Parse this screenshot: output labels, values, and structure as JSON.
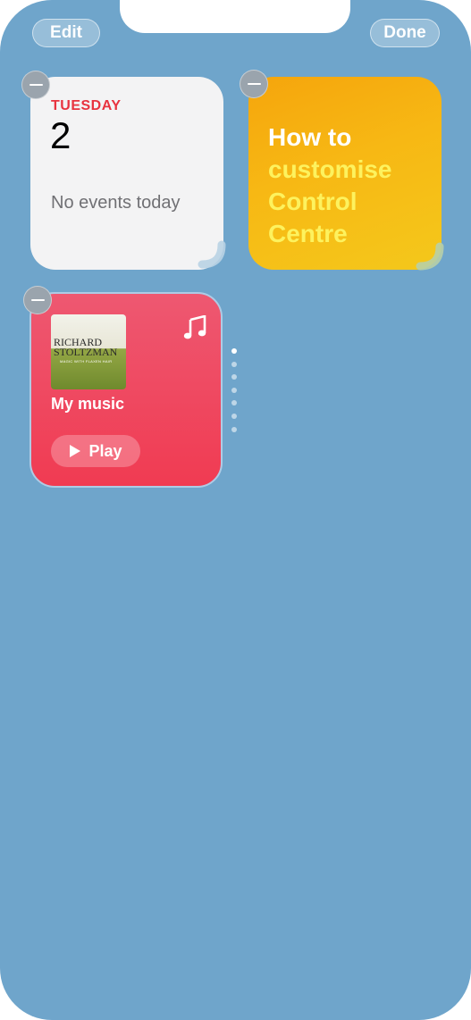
{
  "header": {
    "edit_label": "Edit",
    "done_label": "Done"
  },
  "calendar_widget": {
    "day": "TUESDAY",
    "date": "2",
    "empty_text": "No events today",
    "accent_color": "#e8333f"
  },
  "tips_widget": {
    "line1": "How to",
    "line2": "customise",
    "line3": "Control",
    "line4": "Centre"
  },
  "music_widget": {
    "album_artist_line1": "RICHARD",
    "album_artist_line2": "STOLTZMAN",
    "album_subtitle": "MAGIC WITH FLAXEN HAIR",
    "title": "My music",
    "play_label": "Play",
    "icon": "music-note-icon"
  },
  "page_indicator": {
    "count": 7,
    "active_index": 0
  },
  "colors": {
    "background": "#6fa5cb",
    "music_red": "#f03b52",
    "tips_yellow": "#f7b814"
  }
}
